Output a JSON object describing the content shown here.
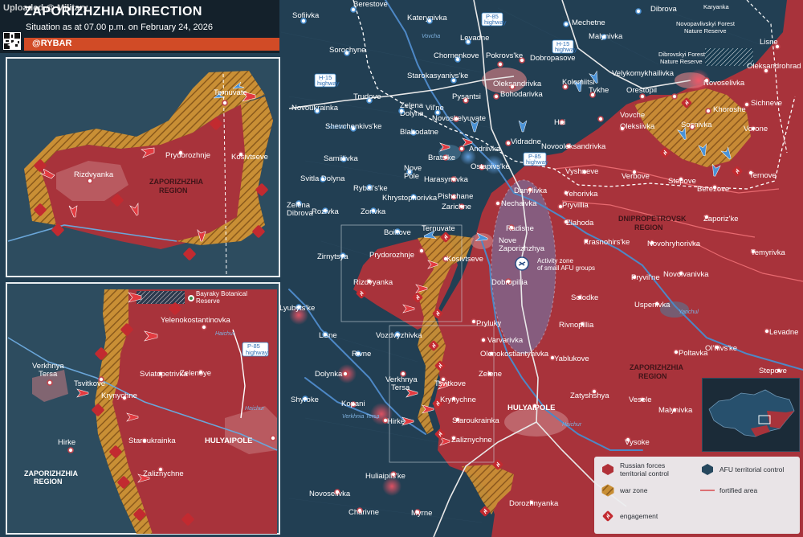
{
  "header": {
    "title": "ZAPORIZHZHIA DIRECTION",
    "subtitle": "Situation as at 07.00 p.m. on February 24, 2026",
    "brand": "@RYBAR",
    "watermark": "Uploaded @ Military"
  },
  "colors": {
    "russian": "#b03038",
    "afu": "#26485e",
    "war_zone": "#d19a3a",
    "engagement": "#c22a30"
  },
  "roads": {
    "p85": "P-85",
    "p85_sub": "highway",
    "h15": "H-15",
    "h15_sub": "highway"
  },
  "regions": {
    "zaporizhzhia": [
      "ZAPORIZHZHIA",
      "REGION"
    ],
    "dnipropetrovsk": [
      "DNIPROPETROVSK",
      "REGION"
    ]
  },
  "rivers": {
    "haichur": "Haichur",
    "vovcha": "Vovcha",
    "yanchul": "Yanchul",
    "verkhnia_tersa": "Verkhnia Tersa"
  },
  "places": {
    "berestove": "Berestove",
    "sofiivka": "Sofiivka",
    "katerynivka": "Katerynivka",
    "dibrova": "Dibrova",
    "karyanka": "Karyanka",
    "mechetne": "Mechetne",
    "malynivka_n": "Malynivka",
    "sorochyne": "Sorochyne",
    "levadne_n": "Levadne",
    "chornenkove": "Chornenkove",
    "pokrovske": "Pokrovs'ke",
    "dobropasove": "Dobropasove",
    "novopavlivskyi": "Novopavlivskyi Forest",
    "nature_reserve": "Nature Reserve",
    "lisne_e": "Lisne",
    "dibrovskyi": "Dibrovskyi Forest",
    "oleksandrohrad": "Oleksandrohrad",
    "starokasyanivske": "Starokasyanivs'ke",
    "oleksandrivka": "Oleksandrivka",
    "kolomiitsi": "Kolomiitsi",
    "velykomykhailivka": "Velykomykhailivka",
    "novoselivka_e": "Novoselivka",
    "trudove": "Trudove",
    "novoukrainka": "Novoukrainka",
    "zelena": "Zelena",
    "dolyna": "Dolyna",
    "vilne": "Vil'ne",
    "pysantsi": "Pysantsi",
    "bohodarivka": "Bohodarivka",
    "tykhe": "Tykhe",
    "orestopil": "Orestopil",
    "sichneve": "Sichneve",
    "khoroshe": "Khoroshe",
    "novoskelyuvate": "Novoskelyuvate",
    "vovche": "Vovche",
    "shevchenkivske": "Shevchenkivs'ke",
    "blahodatne": "Blahodatne",
    "hai": "Hai",
    "oleksiivka": "Oleksiivka",
    "sosnivka": "Sosnivka",
    "vorone": "Vorone",
    "samiilivka": "Samiilivka",
    "andriivka": "Andriivka",
    "vidradne": "Vidradne",
    "novooleksandrivka": "Novooleksandrivka",
    "bratske": "Brats'ke",
    "ostapivske": "Ostapivs'ke",
    "svitla_dolyna": "Svitla Dolyna",
    "nove_pole": "Nove",
    "nove_pole2": "Pole",
    "vyshneve": "Vyshneve",
    "verbove": "Verbove",
    "ternove": "Ternove",
    "rybalske": "Rybal's'ke",
    "harasymivka": "Harasymivka",
    "stepove": "Stepove",
    "berezove": "Berezove",
    "khrystoforivka": "Khrystophorivka",
    "danylivka": "Danylivka",
    "yehorivka": "Yehorivka",
    "zelena_dibrova": "Zelena",
    "zelena_dibrova2": "Dibrova",
    "rozivka": "Rozivka",
    "zorivka": "Zorivka",
    "pishchane": "Pishchane",
    "zarichne": "Zarichne",
    "nechaivka": "Nechaivka",
    "pryvillia": "Pryvillia",
    "zaporizke": "Zaporiz'ke",
    "zlahoda": "Zlahoda",
    "boikove": "Boikove",
    "ternuvate": "Ternuvate",
    "radisne": "Radisne",
    "krasnohirske": "Krasnohirs'ke",
    "novohryhorivka": "Novohryhorivka",
    "zirnytsya": "Zirnytsya",
    "nove_zaporizhzhya": "Nove",
    "nove_zaporizhzhya2": "Zaporizhzhya",
    "prydorozhnje": "Prydorozhnje",
    "kosivtseve": "Kosivtseve",
    "temyrivka": "Temyrivka",
    "activity_zone": "Activity zone",
    "activity_zone2": "of small AFU groups",
    "rizdvyanka": "Rizdvyanka",
    "dobropillia": "Dobropillia",
    "pryvilne": "Pryvil'ne",
    "novoivanivka": "Novoivanivka",
    "uspenivka": "Uspenivka",
    "solodke": "Solodke",
    "lyubytske": "Lyubyts'ke",
    "pryluky": "Pryluky",
    "lisne": "Lisne",
    "vozdvyzhivka": "Vozdvyzhivka",
    "rivnopillia": "Rivnopillia",
    "levadne_e": "Levadne",
    "varvarivka": "Varvarivka",
    "poltavka": "Poltavka",
    "olhivske": "Ol'hivs'ke",
    "rivne": "Rivne",
    "olenokostiantynivka": "Olenokostiantynivka",
    "yablukove": "Yablukove",
    "stepove_e": "Stepove",
    "dolynka": "Dolynka",
    "verkhnia_tersa_m": "Verkhnya",
    "verkhnia_tersa_m2": "Tersa",
    "zelene": "Zelene",
    "tsvitkove": "Tsvitkove",
    "zatyshshya": "Zatyshshya",
    "shyroke": "Shyroke",
    "krynychne": "Krynychne",
    "kopani": "Kopani",
    "veselye": "Vesele",
    "malynivka": "Malynivka",
    "staroukrainka": "Staroukrainka",
    "hulyaipole": "HULYAIPOLE",
    "hirke": "Hirke",
    "zaliznychne": "Zaliznychne",
    "vysoke": "Vysoke",
    "huliaipilske": "Huliaipils'ke",
    "novoselivka": "Novoselivka",
    "dorozhnyanka": "Dorozhnyanka",
    "charivne": "Charivne",
    "myrne": "Myrne"
  },
  "inset_top": {
    "ternuvate": "Ternuvate",
    "prydorozhnje": "Prydorozhnje",
    "kosivtseve": "Kosivtseve",
    "rizdvyanka": "Rizdvyanka",
    "region": [
      "ZAPORIZHZHIA",
      "REGION"
    ]
  },
  "inset_bottom": {
    "bayraky": "Bayraky Botanical",
    "bayraky2": "Reserve",
    "yelenokostantinovka": "Yelenokostantinovka",
    "haichur": "Haichur",
    "p85": "P-85",
    "p85_sub": "highway",
    "verkhnya": "Verkhnya",
    "tersa": "Tersa",
    "tsvitkove": "Tsvitkove",
    "sviatopetrivka": "Sviatopetrivka",
    "zelenoye": "Zelenoye",
    "krynychne": "Krynychne",
    "hirke": "Hirke",
    "staroukrainka": "Staroukrainka",
    "hulyaipole": "HULYAIPOLE",
    "zaliznychne": "Zaliznychne",
    "region": [
      "ZAPORIZHZHIA",
      "REGION"
    ],
    "haichur2": "Haichur"
  },
  "legend": {
    "russian": "Russian forces territorial control",
    "afu": "AFU territorial control",
    "war_zone": "war zone",
    "fortified": "fortified area",
    "engagement": "engagement"
  }
}
